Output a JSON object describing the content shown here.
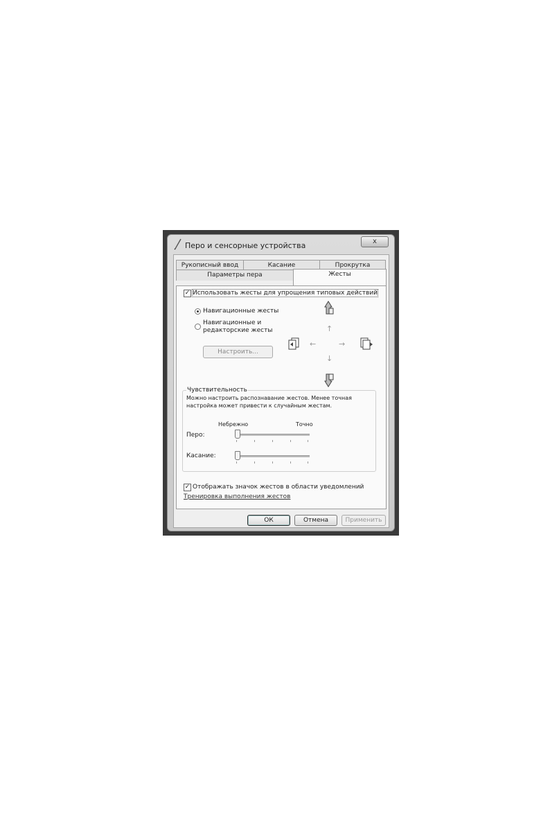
{
  "window": {
    "title": "Перо и сенсорные устройства",
    "close_symbol": "x"
  },
  "tabs": [
    {
      "label": "Рукописный ввод"
    },
    {
      "label": "Касание"
    },
    {
      "label": "Прокрутка"
    },
    {
      "label": "Параметры пера"
    },
    {
      "label": "Жесты",
      "active": true
    }
  ],
  "gestures": {
    "use_gestures_label": "Использовать жесты для упрощения типовых действий",
    "use_gestures_checked": true,
    "nav_gestures_label": "Навигационные жесты",
    "nav_edit_gestures_label_line1": "Навигационные и",
    "nav_edit_gestures_label_line2": "редакторские жесты",
    "selected_mode": "Навигационные жесты",
    "customize_button": "Настроить..."
  },
  "icons": {
    "up": "hand-up-icon",
    "down": "hand-down-icon",
    "left": "page-back-icon",
    "right": "page-forward-icon"
  },
  "arrows": {
    "up": "↑",
    "down": "↓",
    "left": "←",
    "right": "→"
  },
  "sensitivity": {
    "title": "Чувствительность",
    "description_line1": "Можно настроить распознавание жестов. Менее точная",
    "description_line2": "настройка может привести к случайным жестам.",
    "scale_low": "Небрежно",
    "scale_high": "Точно",
    "pen_label": "Перо:",
    "pen_value": 0,
    "touch_label": "Касание:",
    "touch_value": 0
  },
  "footer": {
    "show_icon_label": "Отображать значок жестов в области уведомлений",
    "show_icon_checked": true,
    "training_link": "Тренировка выполнения жестов"
  },
  "buttons": {
    "ok": "ОК",
    "cancel": "Отмена",
    "apply": "Применить"
  }
}
